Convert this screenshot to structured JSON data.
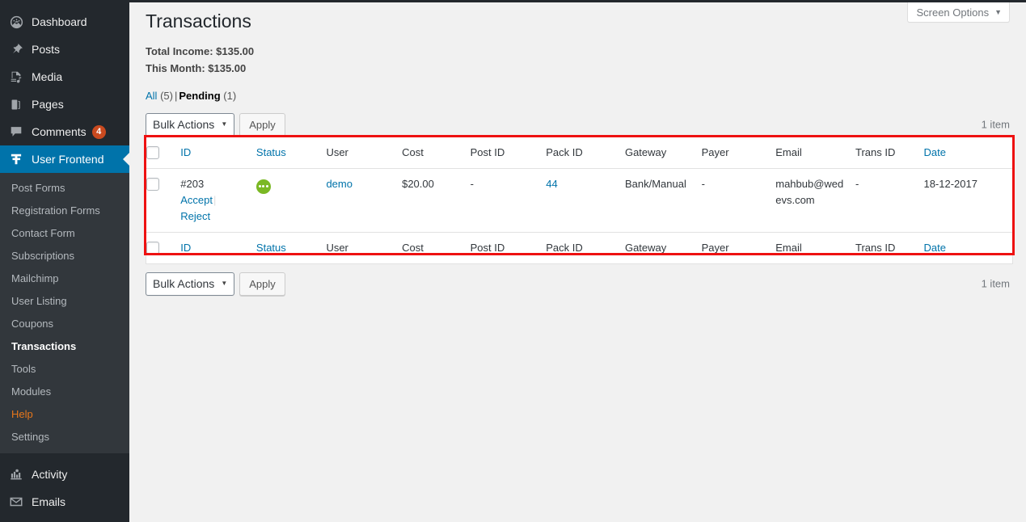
{
  "sidebar": {
    "top_items": [
      {
        "label": "Dashboard",
        "icon": "dashboard-icon",
        "badge": null,
        "current": false
      },
      {
        "label": "Posts",
        "icon": "pin-icon",
        "badge": null,
        "current": false
      },
      {
        "label": "Media",
        "icon": "media-icon",
        "badge": null,
        "current": false
      },
      {
        "label": "Pages",
        "icon": "pages-icon",
        "badge": null,
        "current": false
      },
      {
        "label": "Comments",
        "icon": "comment-icon",
        "badge": "4",
        "current": false
      },
      {
        "label": "User Frontend",
        "icon": "user-frontend-icon",
        "badge": null,
        "current": true
      }
    ],
    "submenu": [
      {
        "label": "Post Forms",
        "state": "normal"
      },
      {
        "label": "Registration Forms",
        "state": "normal"
      },
      {
        "label": "Contact Form",
        "state": "normal"
      },
      {
        "label": "Subscriptions",
        "state": "normal"
      },
      {
        "label": "Mailchimp",
        "state": "normal"
      },
      {
        "label": "User Listing",
        "state": "normal"
      },
      {
        "label": "Coupons",
        "state": "normal"
      },
      {
        "label": "Transactions",
        "state": "current"
      },
      {
        "label": "Tools",
        "state": "normal"
      },
      {
        "label": "Modules",
        "state": "normal"
      },
      {
        "label": "Help",
        "state": "help"
      },
      {
        "label": "Settings",
        "state": "normal"
      }
    ],
    "bottom_items": [
      {
        "label": "Activity",
        "icon": "activity-icon"
      },
      {
        "label": "Emails",
        "icon": "envelope-icon"
      }
    ]
  },
  "screen_options": {
    "label": "Screen Options",
    "caret": "▼"
  },
  "page": {
    "title": "Transactions",
    "total_income": "Total Income: $135.00",
    "this_month": "This Month: $135.00"
  },
  "filters": {
    "all_label": "All",
    "all_count": "(5)",
    "separator": "|",
    "pending_label": "Pending",
    "pending_count": "(1)"
  },
  "toolbar": {
    "bulk_actions_label": "Bulk Actions",
    "bulk_caret": "▼",
    "apply_label": "Apply",
    "item_count_top": "1 item",
    "item_count_bottom": "1 item"
  },
  "table": {
    "columns": [
      {
        "key": "id",
        "label": "ID",
        "sortable": true
      },
      {
        "key": "status",
        "label": "Status",
        "sortable": true
      },
      {
        "key": "user",
        "label": "User",
        "sortable": false
      },
      {
        "key": "cost",
        "label": "Cost",
        "sortable": false
      },
      {
        "key": "post_id",
        "label": "Post ID",
        "sortable": false
      },
      {
        "key": "pack_id",
        "label": "Pack ID",
        "sortable": false
      },
      {
        "key": "gateway",
        "label": "Gateway",
        "sortable": false
      },
      {
        "key": "payer",
        "label": "Payer",
        "sortable": false
      },
      {
        "key": "email",
        "label": "Email",
        "sortable": false
      },
      {
        "key": "trans_id",
        "label": "Trans ID",
        "sortable": false
      },
      {
        "key": "date",
        "label": "Date",
        "sortable": true
      }
    ],
    "rows": [
      {
        "id": "#203",
        "actions": [
          {
            "label": "Accept"
          },
          {
            "label": "Reject"
          }
        ],
        "action_divider": "|",
        "status_icon": "pending-status-icon",
        "status_color": "#7ab824",
        "user": "demo",
        "cost": "$20.00",
        "post_id": "-",
        "pack_id": "44",
        "gateway": "Bank/Manual",
        "payer": "-",
        "email": "mahbub@wedevs.com",
        "trans_id": "-",
        "date": "18-12-2017"
      }
    ]
  },
  "annotation": {
    "color": "#ee1111"
  },
  "theme": {
    "sidebar_bg": "#23282d",
    "submenu_bg": "#32373c",
    "accent_blue": "#0073aa",
    "badge_red": "#ca4a1f",
    "help_orange": "#e7761a",
    "content_bg": "#f1f1f1"
  }
}
